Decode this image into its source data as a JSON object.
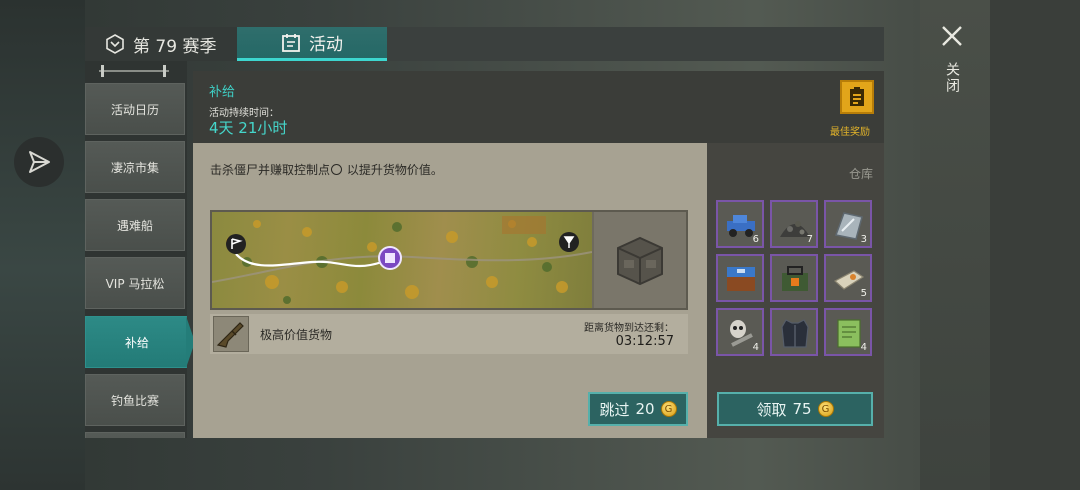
{
  "top_tabs": {
    "season": "第 79 赛季",
    "activity": "活动"
  },
  "close_label": "关闭",
  "sidenav": {
    "items": [
      "活动日历",
      "凄凉市集",
      "遇难船",
      "VIP 马拉松",
      "补给",
      "钓鱼比赛"
    ],
    "active_index": 4
  },
  "event": {
    "title": "补给",
    "duration_label": "活动持续时间：",
    "duration": "4天 21小时",
    "best_reward_label": "最佳奖励"
  },
  "content": {
    "description_before": "击杀僵尸并赚取控制点",
    "description_after": "以提升货物价值。",
    "cargo_name": "极高价值货物",
    "eta_label": "距离货物到达还剩：",
    "eta": "03:12:57",
    "skip_label": "跳过",
    "skip_cost": "20"
  },
  "warehouse": {
    "label": "仓库",
    "items": [
      {
        "icon": "blue-vehicle-icon",
        "qty": "6"
      },
      {
        "icon": "gravel-pile-icon",
        "qty": "7"
      },
      {
        "icon": "metal-plate-icon",
        "qty": "3"
      },
      {
        "icon": "blue-crate-icon",
        "qty": ""
      },
      {
        "icon": "battery-pack-icon",
        "qty": ""
      },
      {
        "icon": "fabric-roll-icon",
        "qty": "5"
      },
      {
        "icon": "mask-tools-icon",
        "qty": "4"
      },
      {
        "icon": "armor-vest-icon",
        "qty": ""
      },
      {
        "icon": "notebook-icon",
        "qty": "4"
      }
    ],
    "claim_label": "领取",
    "claim_cost": "75"
  },
  "colors": {
    "accent": "#3fd0c6",
    "gold": "#e2a51a",
    "rarity_purple": "#7a55a8"
  }
}
